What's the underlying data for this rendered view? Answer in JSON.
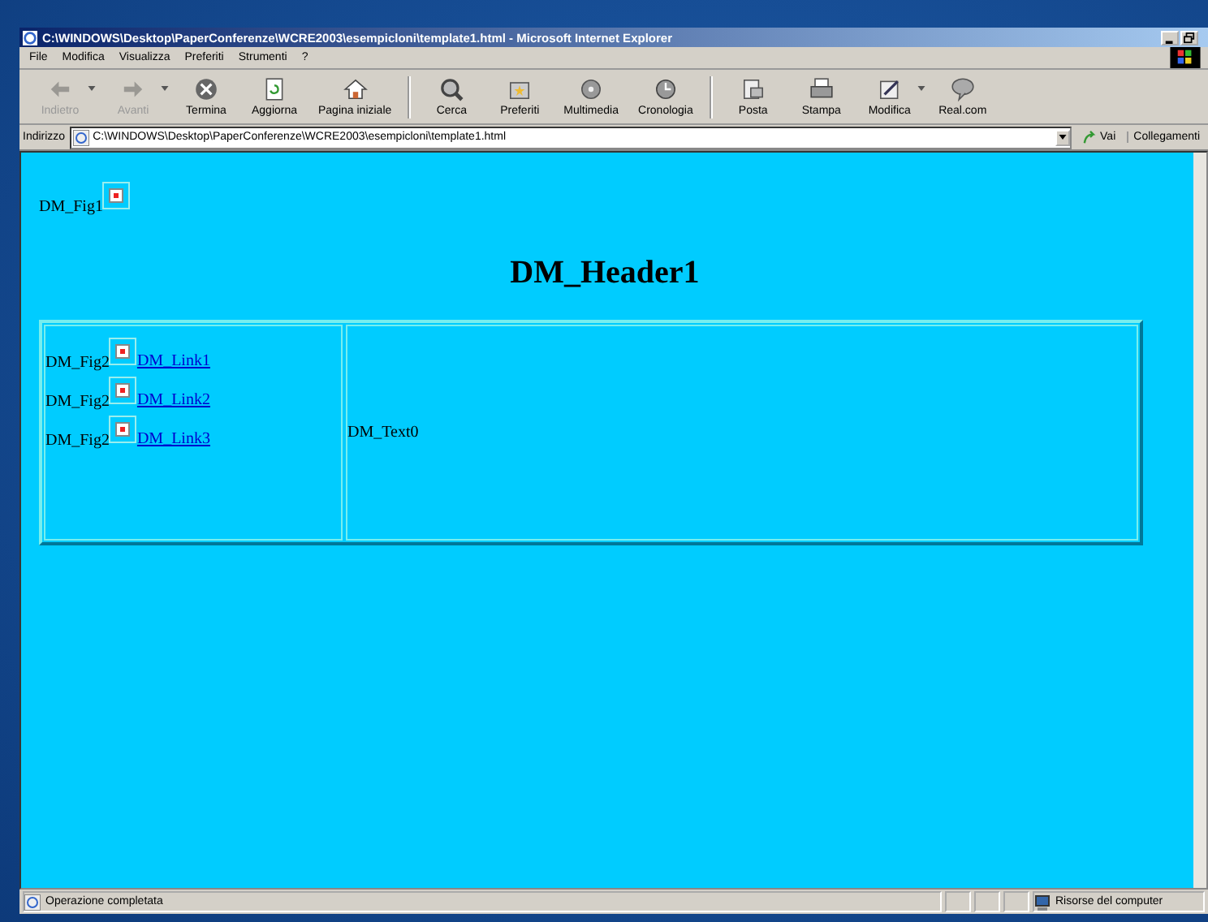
{
  "window": {
    "title": "C:\\WINDOWS\\Desktop\\PaperConferenze\\WCRE2003\\esempicloni\\template1.html - Microsoft Internet Explorer"
  },
  "menu": [
    "File",
    "Modifica",
    "Visualizza",
    "Preferiti",
    "Strumenti",
    "?"
  ],
  "toolbar": [
    [
      {
        "kind": "back",
        "label": "Indietro",
        "disabled": true,
        "dropdown": true
      },
      {
        "kind": "forward",
        "label": "Avanti",
        "disabled": true,
        "dropdown": true
      },
      {
        "kind": "stop",
        "label": "Termina",
        "disabled": false,
        "dropdown": false
      },
      {
        "kind": "refresh",
        "label": "Aggiorna",
        "disabled": false,
        "dropdown": false
      },
      {
        "kind": "home",
        "label": "Pagina iniziale",
        "disabled": false,
        "dropdown": false
      }
    ],
    [
      {
        "kind": "search",
        "label": "Cerca",
        "disabled": false,
        "dropdown": false
      },
      {
        "kind": "favorites",
        "label": "Preferiti",
        "disabled": false,
        "dropdown": false
      },
      {
        "kind": "media",
        "label": "Multimedia",
        "disabled": false,
        "dropdown": false
      },
      {
        "kind": "history",
        "label": "Cronologia",
        "disabled": false,
        "dropdown": false
      }
    ],
    [
      {
        "kind": "mail",
        "label": "Posta",
        "disabled": false,
        "dropdown": false
      },
      {
        "kind": "print",
        "label": "Stampa",
        "disabled": false,
        "dropdown": false
      },
      {
        "kind": "edit",
        "label": "Modifica",
        "disabled": false,
        "dropdown": true
      },
      {
        "kind": "discuss",
        "label": "Real.com",
        "disabled": false,
        "dropdown": false
      }
    ]
  ],
  "address": {
    "label": "Indirizzo",
    "value": "C:\\WINDOWS\\Desktop\\PaperConferenze\\WCRE2003\\esempicloni\\template1.html",
    "go": "Vai",
    "links": "Collegamenti"
  },
  "page": {
    "top_figure": "DM_Fig1",
    "header": "DM_Header1",
    "rows": [
      {
        "figure": "DM_Fig2",
        "link": "DM_Link1"
      },
      {
        "figure": "DM_Fig2",
        "link": "DM_Link2"
      },
      {
        "figure": "DM_Fig2",
        "link": "DM_Link3"
      }
    ],
    "text": "DM_Text0"
  },
  "status_bar": {
    "message": "Operazione completata",
    "zone": "Risorse del computer"
  }
}
